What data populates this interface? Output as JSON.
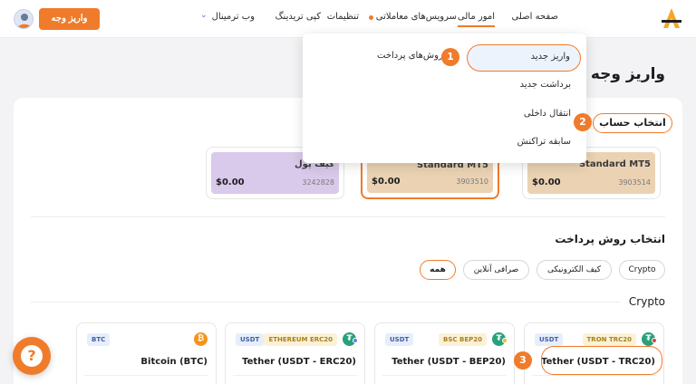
{
  "header": {
    "logo": "A",
    "nav": {
      "home": "صفحه اصلی",
      "finance": "امور مالی",
      "trading_services": "سرویس‌های معاملاتی",
      "settings": "تنظیمات",
      "copy_trading": "کپی تریدینگ",
      "web_terminal": "وب ترمینال"
    },
    "deposit_button": "واریز وجه"
  },
  "page_title": "واریز وجه",
  "dropdown": {
    "label": "روش‌های پرداخت",
    "items": [
      "واریز جدید",
      "برداشت جدید",
      "انتقال داخلی",
      "سابقه تراکنش"
    ]
  },
  "steps": [
    "1",
    "2",
    "3"
  ],
  "account_section": {
    "title": "انتخاب حساب",
    "accounts": [
      {
        "name": "Standard MT5",
        "balance": "$0.00",
        "number": "3903514",
        "color": "#ead2b3"
      },
      {
        "name": "Standard MT5",
        "balance": "$0.00",
        "number": "3903510",
        "color": "#ead2b3"
      },
      {
        "name": "کیف پول",
        "balance": "$0.00",
        "number": "3242828",
        "color": "#d9c9ea"
      }
    ]
  },
  "payment_section": {
    "title": "انتخاب روش پرداخت",
    "filters": [
      "Crypto",
      "کیف الکترونیکی",
      "صرافی آنلاین",
      "همه"
    ],
    "group_label": "Crypto"
  },
  "coins": [
    {
      "network_tag": "TRON TRC20",
      "asset_tag": "USDT",
      "name": "Tether (USDT - TRC20)",
      "icon_color": "#26a17b",
      "icon": "₮"
    },
    {
      "network_tag": "BSC BEP20",
      "asset_tag": "USDT",
      "name": "Tether (USDT - BEP20)",
      "icon_color": "#26a17b",
      "icon": "₮"
    },
    {
      "network_tag": "ETHEREUM ERC20",
      "asset_tag": "USDT",
      "name": "Tether (USDT - ERC20)",
      "icon_color": "#26a17b",
      "icon": "₮"
    },
    {
      "network_tag": "",
      "asset_tag": "BTC",
      "name": "Bitcoin (BTC)",
      "icon_color": "#f7931a",
      "icon": "₿"
    }
  ],
  "help_icon": "?",
  "colors": {
    "accent": "#f07b2b",
    "mt5_card": "#ead2b3",
    "wallet_card": "#d9c9ea",
    "tether": "#26a17b",
    "bitcoin": "#f7931a"
  }
}
